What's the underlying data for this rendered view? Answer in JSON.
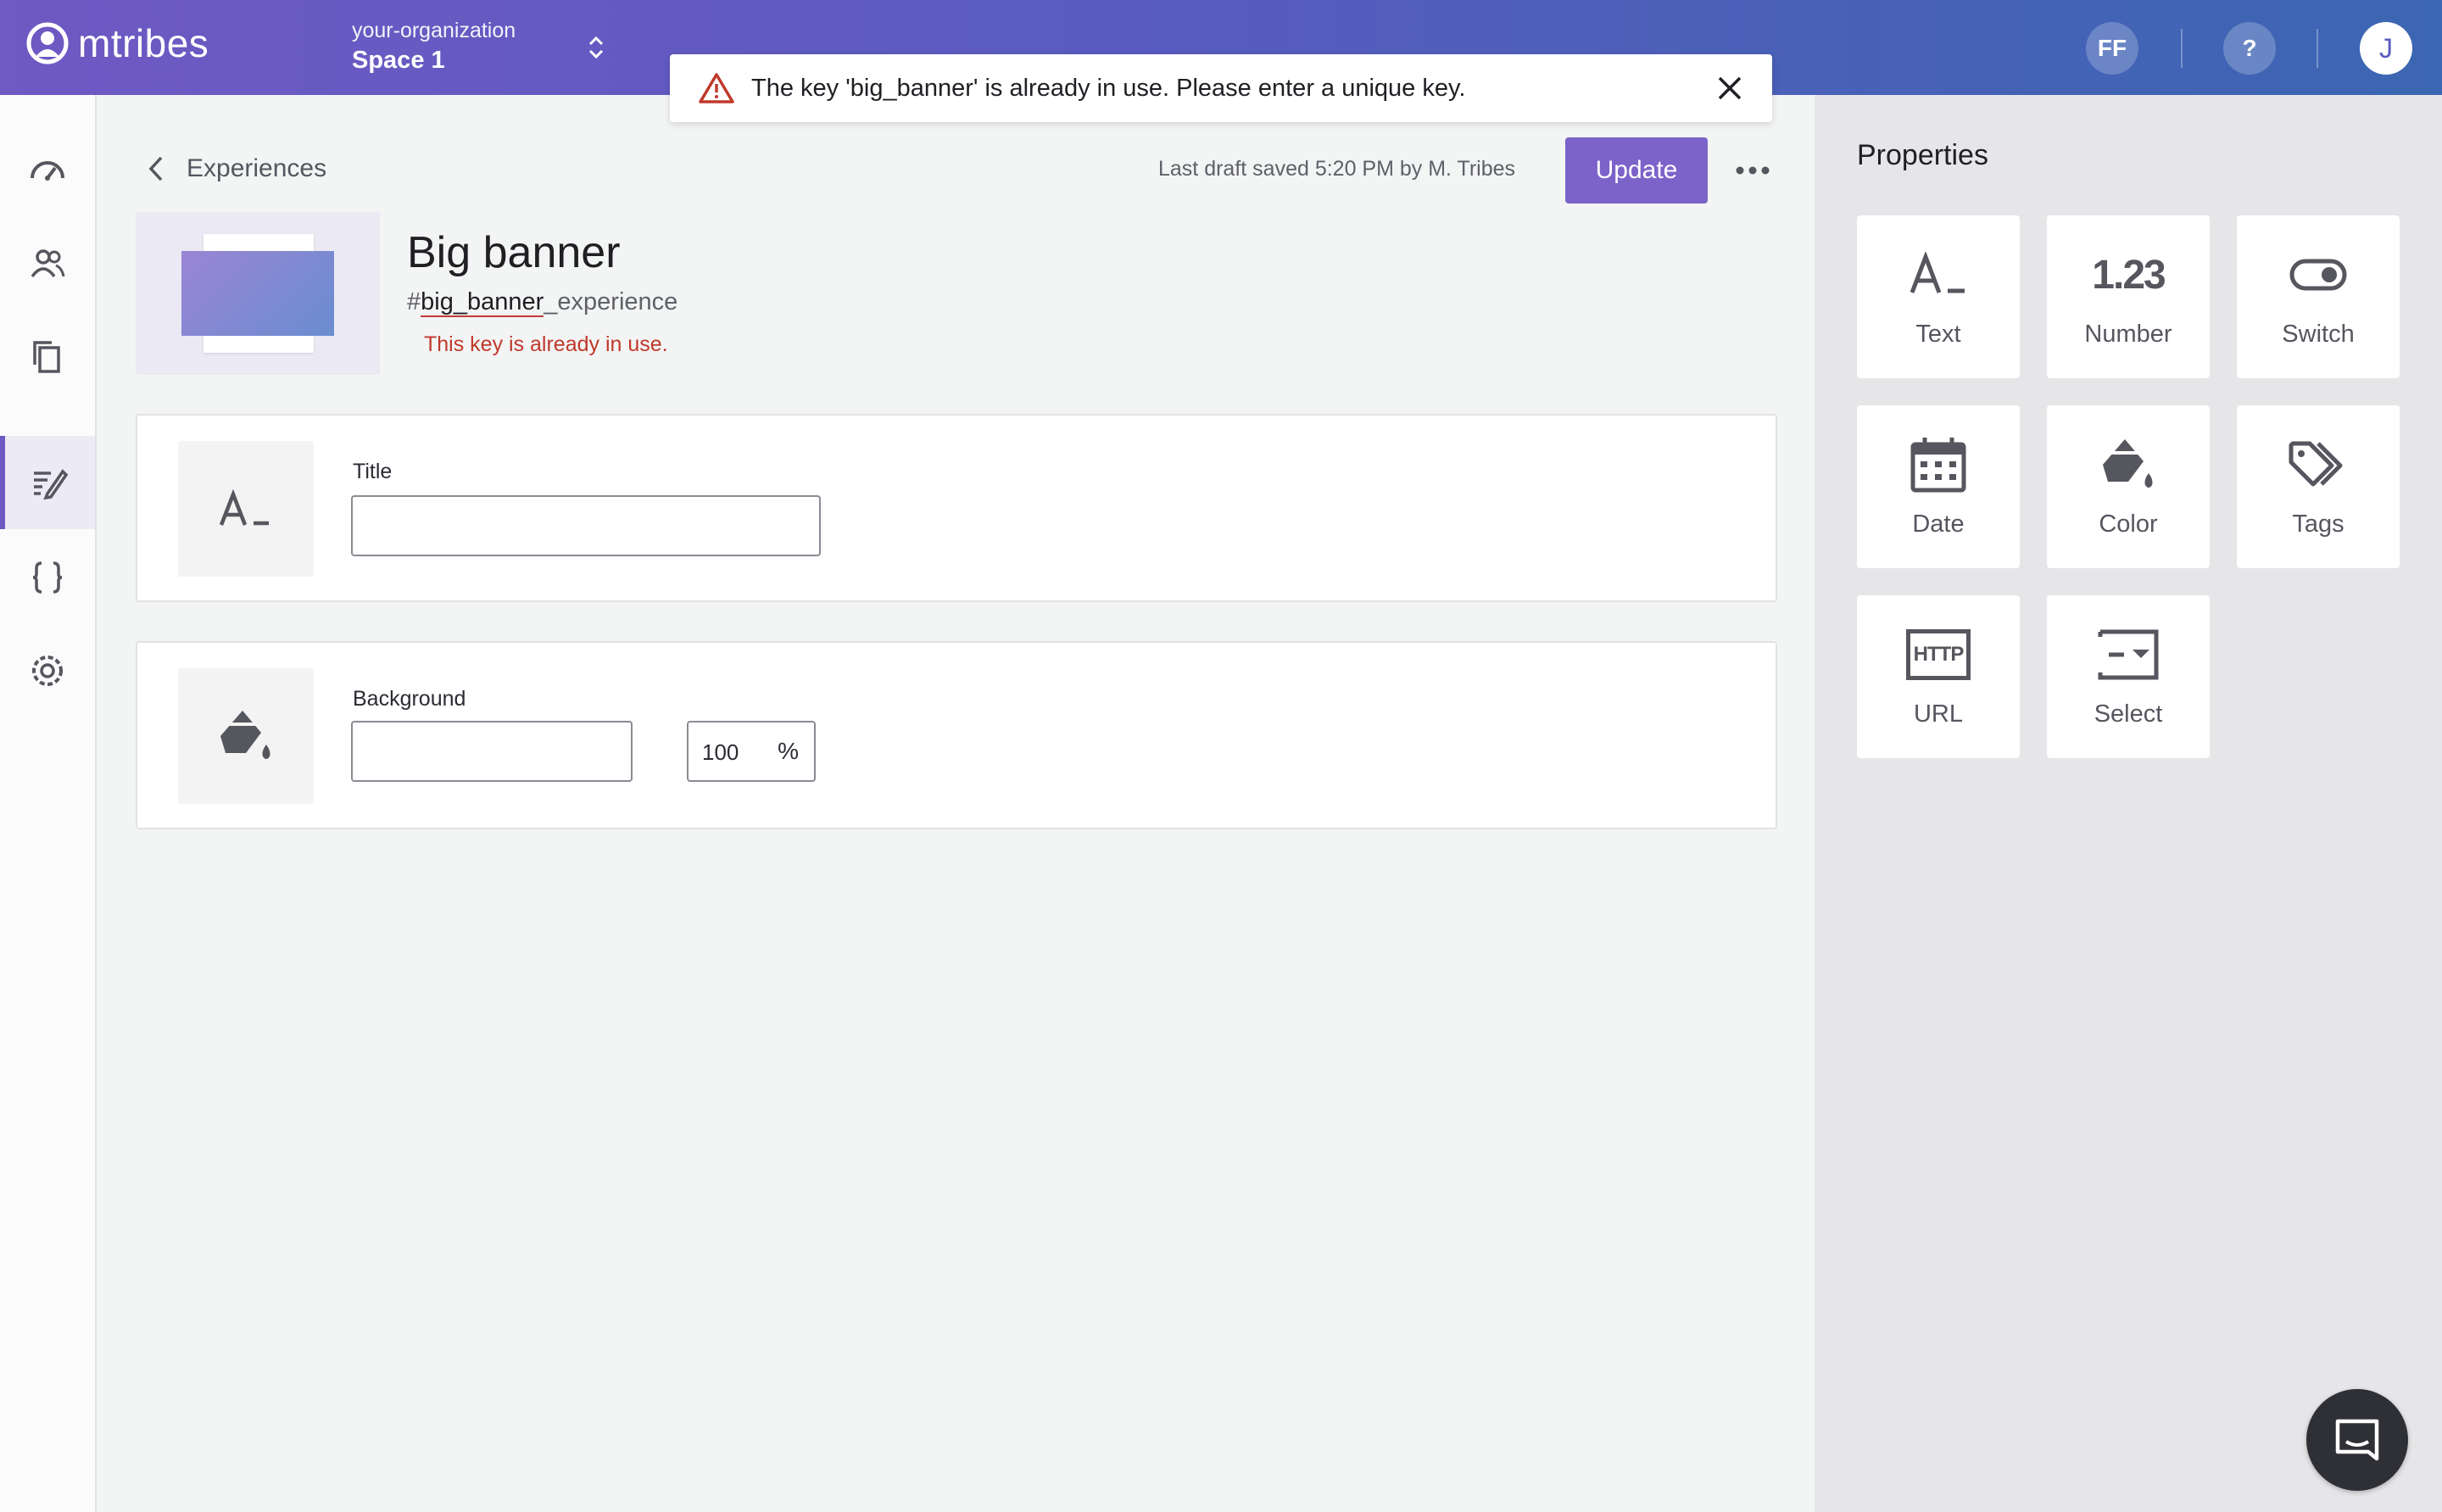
{
  "header": {
    "app_name": "mtribes",
    "org_name": "your-organization",
    "space_name": "Space 1",
    "ff_initials": "FF",
    "help_label": "?",
    "user_initial": "J"
  },
  "toast": {
    "message": "The key 'big_banner' is already in use. Please enter a unique key."
  },
  "nav": {
    "items": [
      "dashboard-icon",
      "people-icon",
      "copy-icon",
      "experiences-icon",
      "code-icon",
      "settings-icon"
    ],
    "active": "experiences-icon"
  },
  "main": {
    "back_label": "Experiences",
    "saved_text": "Last draft saved 5:20 PM by M. Tribes",
    "update_label": "Update",
    "experience_title": "Big banner",
    "key_hash": "#",
    "key_main": "big_banner",
    "key_suffix": "_experience",
    "key_error": "This key is already in use.",
    "properties": [
      {
        "label": "Title",
        "value": ""
      },
      {
        "label": "Background",
        "value": "",
        "opacity": "100",
        "opacity_unit": "%"
      }
    ]
  },
  "panel": {
    "title": "Properties",
    "tiles": [
      {
        "label": "Text",
        "icon": "text-icon"
      },
      {
        "label": "Number",
        "icon": "number-icon",
        "glyph": "1.23"
      },
      {
        "label": "Switch",
        "icon": "switch-icon"
      },
      {
        "label": "Date",
        "icon": "calendar-icon"
      },
      {
        "label": "Color",
        "icon": "paint-bucket-icon"
      },
      {
        "label": "Tags",
        "icon": "tags-icon"
      },
      {
        "label": "URL",
        "icon": "http-icon",
        "glyph": "HTTP"
      },
      {
        "label": "Select",
        "icon": "select-icon"
      }
    ]
  },
  "colors": {
    "accent": "#7b63c9",
    "error": "#c0392b",
    "header_start": "#6f59c3",
    "header_end": "#3b66b2"
  }
}
